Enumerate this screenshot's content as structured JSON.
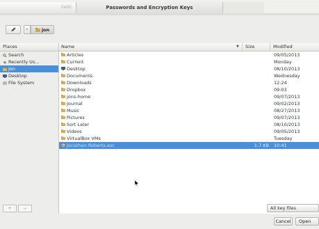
{
  "window": {
    "title": "Passwords and Encryption Keys",
    "left_tab": "2edit",
    "right_tab": ""
  },
  "toolbar": {
    "edit_icon": "pencil-icon",
    "back_label": "‹",
    "path_label": "jon"
  },
  "places": {
    "header": "Places",
    "items": [
      {
        "label": "Search",
        "icon": "search-icon"
      },
      {
        "label": "Recently Us...",
        "icon": "recent-icon"
      },
      {
        "label": "jon",
        "icon": "home-folder-icon",
        "selected": true
      },
      {
        "label": "Desktop",
        "icon": "desktop-icon"
      },
      {
        "label": "File System",
        "icon": "drive-icon"
      }
    ],
    "add_label": "+",
    "remove_label": "−"
  },
  "files": {
    "columns": {
      "name": "Name",
      "size": "Size",
      "modified": "Modified"
    },
    "rows": [
      {
        "name": "Articles",
        "size": "",
        "modified": "09/05/2013",
        "kind": "folder"
      },
      {
        "name": "Current",
        "size": "",
        "modified": "Monday",
        "kind": "folder"
      },
      {
        "name": "Desktop",
        "size": "",
        "modified": "08/10/2013",
        "kind": "desktop"
      },
      {
        "name": "Documents",
        "size": "",
        "modified": "Wednesday",
        "kind": "folder"
      },
      {
        "name": "Downloads",
        "size": "",
        "modified": "12:24",
        "kind": "folder"
      },
      {
        "name": "Dropbox",
        "size": "",
        "modified": "09:03",
        "kind": "folder"
      },
      {
        "name": "jons-home",
        "size": "",
        "modified": "09/07/2013",
        "kind": "folder"
      },
      {
        "name": "Journal",
        "size": "",
        "modified": "09/02/2013",
        "kind": "folder"
      },
      {
        "name": "Music",
        "size": "",
        "modified": "08/27/2013",
        "kind": "folder"
      },
      {
        "name": "Pictures",
        "size": "",
        "modified": "09/07/2013",
        "kind": "folder"
      },
      {
        "name": "Sort Later",
        "size": "",
        "modified": "08/10/2013",
        "kind": "folder"
      },
      {
        "name": "Videos",
        "size": "",
        "modified": "09/05/2013",
        "kind": "folder"
      },
      {
        "name": "VirtualBox VMs",
        "size": "",
        "modified": "Tuesday",
        "kind": "folder"
      },
      {
        "name": "Jonathan Roberts.asc",
        "size": "1.7 KB",
        "modified": "10:41",
        "kind": "file",
        "selected": true
      }
    ]
  },
  "filter": {
    "label": "All key files"
  },
  "buttons": {
    "cancel": "Cancel",
    "open": "Open"
  },
  "colors": {
    "selection": "#4a90d9",
    "folder": "#c8a24a"
  }
}
